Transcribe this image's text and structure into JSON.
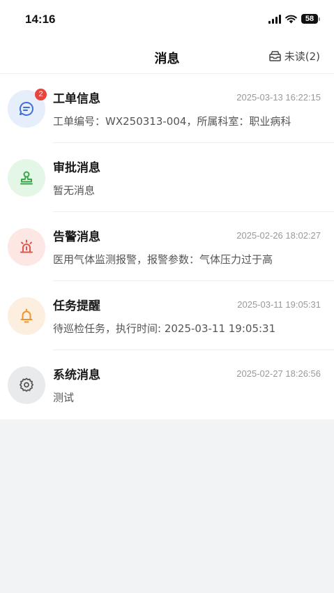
{
  "status_bar": {
    "time": "14:16",
    "battery": "58"
  },
  "nav": {
    "title": "消息",
    "unread_label": "未读(2)"
  },
  "messages": [
    {
      "title": "工单信息",
      "time": "2025-03-13 16:22:15",
      "desc": "工单编号：WX250313-004，所属科室：职业病科",
      "badge": "2",
      "icon": "chat-bubble-icon",
      "color": "#3d6fd9",
      "bg": "#e6edfb"
    },
    {
      "title": "审批消息",
      "time": "",
      "desc": "暂无消息",
      "badge": "",
      "icon": "stamp-icon",
      "color": "#3aa64a",
      "bg": "#e4f6e6"
    },
    {
      "title": "告警消息",
      "time": "2025-02-26 18:02:27",
      "desc": "医用气体监测报警，报警参数：气体压力过于高",
      "badge": "",
      "icon": "alarm-light-icon",
      "color": "#e0564a",
      "bg": "#fde7e5"
    },
    {
      "title": "任务提醒",
      "time": "2025-03-11 19:05:31",
      "desc": "待巡检任务，执行时间: 2025-03-11 19:05:31",
      "badge": "",
      "icon": "bell-icon",
      "color": "#f0922d",
      "bg": "#fdefdf"
    },
    {
      "title": "系统消息",
      "time": "2025-02-27 18:26:56",
      "desc": "测试",
      "badge": "",
      "icon": "gear-icon",
      "color": "#555555",
      "bg": "#e9eaec"
    }
  ]
}
